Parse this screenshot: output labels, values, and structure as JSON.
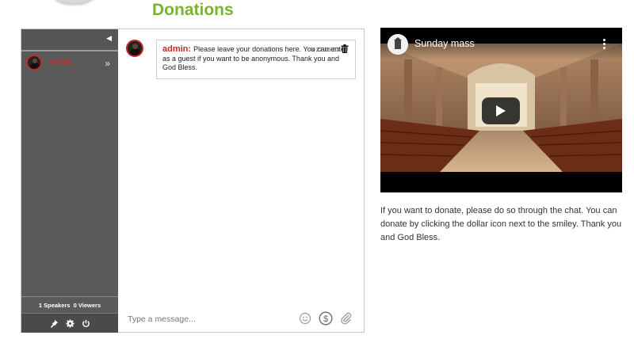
{
  "page": {
    "title": "Donations"
  },
  "chat": {
    "sidebar": {
      "collapse_icon": "triangle-left-icon",
      "users": [
        {
          "name": "admin",
          "more_icon": "double-chevron-right-icon"
        }
      ],
      "stats": {
        "speakers_count": "1",
        "speakers_label": "Speakers",
        "viewers_count": "0",
        "viewers_label": "Viewers"
      },
      "actions": [
        "pin-icon",
        "gear-icon",
        "power-icon"
      ]
    },
    "messages": [
      {
        "author": "admin:",
        "text": "Please leave your donations here. You can enter as a guest if you want to be anonymous. Thank you and God Bless.",
        "time": "03-27 15:03",
        "action_icon": "trash-icon"
      }
    ],
    "composer": {
      "placeholder": "Type a message...",
      "icons": [
        "smiley-icon",
        "dollar-icon",
        "paperclip-icon"
      ]
    },
    "colors": {
      "username": "#c62828",
      "sidebar": "#5a5a5a"
    }
  },
  "video": {
    "title": "Sunday mass",
    "play_icon": "play-icon",
    "menu_icon": "vertical-dots-icon"
  },
  "description": "If you want to donate, please do so through the chat. You can donate by clicking the dollar icon next to the smiley. Thank you and God Bless.",
  "colors": {
    "title": "#7ab32e"
  }
}
